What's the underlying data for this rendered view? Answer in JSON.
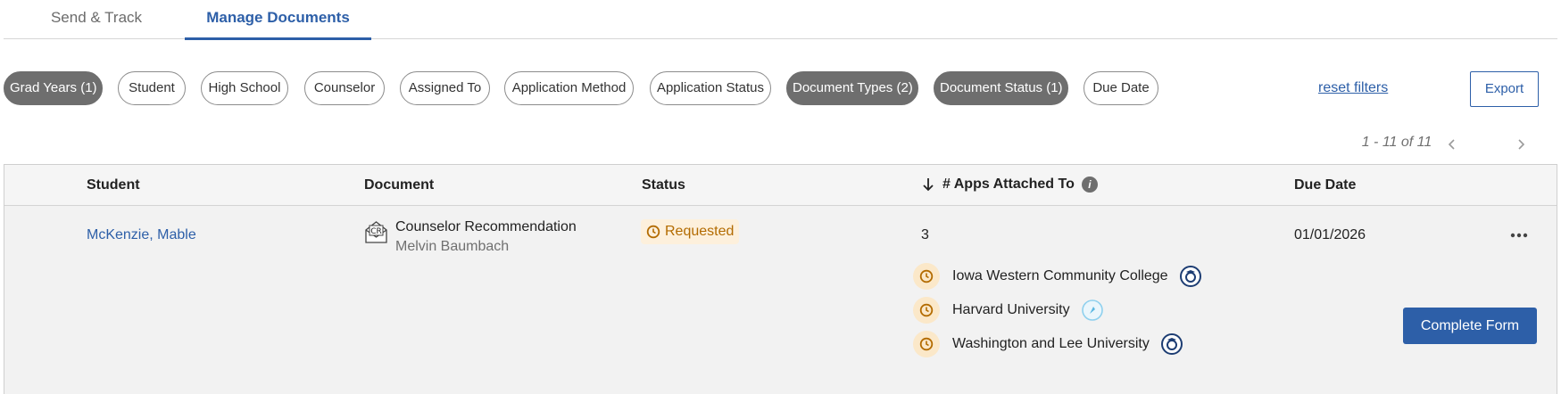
{
  "tabs": [
    {
      "label": "Send & Track",
      "active": false
    },
    {
      "label": "Manage Documents",
      "active": true
    }
  ],
  "filters": {
    "chips": [
      {
        "label": "Grad Years (1)",
        "active": true
      },
      {
        "label": "Student",
        "active": false
      },
      {
        "label": "High School",
        "active": false
      },
      {
        "label": "Counselor",
        "active": false
      },
      {
        "label": "Assigned To",
        "active": false
      },
      {
        "label": "Application Method",
        "active": false
      },
      {
        "label": "Application Status",
        "active": false
      },
      {
        "label": "Document Types (2)",
        "active": true
      },
      {
        "label": "Document Status (1)",
        "active": true
      },
      {
        "label": "Due Date",
        "active": false
      }
    ],
    "reset_label": "reset filters",
    "export_label": "Export"
  },
  "pagination": {
    "text": "1 - 11 of 11"
  },
  "table": {
    "headers": {
      "student": "Student",
      "document": "Document",
      "status": "Status",
      "apps": "# Apps Attached To",
      "due": "Due Date"
    },
    "rows": [
      {
        "student": "McKenzie, Mable",
        "document_title": "Counselor Recommendation",
        "document_sub": "Melvin Baumbach",
        "document_icon_text": "CR",
        "status": "Requested",
        "apps_count": "3",
        "due_date": "01/01/2026",
        "schools": [
          {
            "name": "Iowa Western Community College",
            "method_icon": "common-app-icon"
          },
          {
            "name": "Harvard University",
            "method_icon": "coalition-app-icon"
          },
          {
            "name": "Washington and Lee University",
            "method_icon": "common-app-icon"
          }
        ],
        "action_label": "Complete Form"
      }
    ]
  },
  "colors": {
    "brand": "#2d5fa8",
    "active_chip": "#6e6e6e",
    "status_requested_text": "#b36b00",
    "status_requested_bg": "#fdf0dc"
  }
}
